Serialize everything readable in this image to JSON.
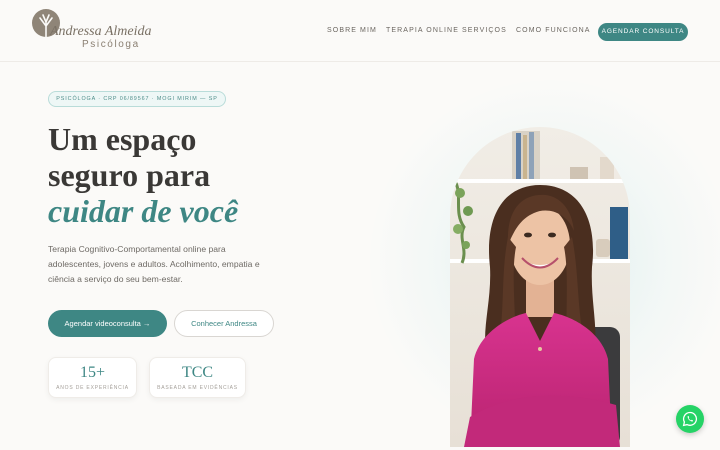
{
  "brand": {
    "name": "Andressa Almeida",
    "subtitle": "Psicóloga",
    "logo_icon": "tree-icon",
    "accent_color": "#3e8784"
  },
  "nav": {
    "items": [
      {
        "label": "SOBRE MIM"
      },
      {
        "label": "TERAPIA ONLINE"
      },
      {
        "label": "SERVIÇOS"
      },
      {
        "label": "COMO FUNCIONA"
      }
    ],
    "cta_label": "AGENDAR CONSULTA"
  },
  "hero": {
    "badge": "PSICÓLOGA · CRP 06/89567 · MOGI MIRIM — SP",
    "headline_line1": "Um espaço",
    "headline_line2": "seguro para",
    "headline_accent": "cuidar de você",
    "description": "Terapia Cognitivo-Comportamental online para adolescentes, jovens e adultos. Acolhimento, empatia e ciência a serviço do seu bem-estar.",
    "primary_button": "Agendar videoconsulta →",
    "secondary_button": "Conhecer Andressa",
    "stats": [
      {
        "value": "15+",
        "label": "ANOS DE EXPERIÊNCIA"
      },
      {
        "value": "TCC",
        "label": "BASEADA EM EVIDÊNCIAS"
      }
    ]
  },
  "floating": {
    "whatsapp_icon": "whatsapp-icon",
    "whatsapp_color": "#25d366"
  }
}
